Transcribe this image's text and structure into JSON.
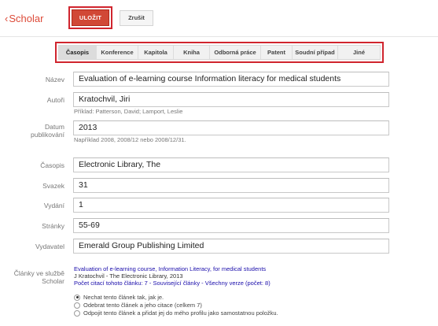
{
  "header": {
    "back_label": "Scholar",
    "save_label": "ULOŽIT",
    "cancel_label": "Zrušit"
  },
  "tabs": [
    {
      "label": "Časopis",
      "active": true
    },
    {
      "label": "Konference",
      "active": false
    },
    {
      "label": "Kapitola",
      "active": false
    },
    {
      "label": "Kniha",
      "active": false
    },
    {
      "label": "Odborná práce",
      "active": false
    },
    {
      "label": "Patent",
      "active": false
    },
    {
      "label": "Soudní případ",
      "active": false
    },
    {
      "label": "Jiné",
      "active": false
    }
  ],
  "form": {
    "title": {
      "label": "Název",
      "value": "Evaluation of e-learning course Information literacy for medical students"
    },
    "authors": {
      "label": "Autoři",
      "value": "Kratochvil, Jiri",
      "hint": "Příklad: Patterson, David; Lamport, Leslie"
    },
    "date": {
      "label_line1": "Datum",
      "label_line2": "publikování",
      "value": "2013",
      "hint": "Například 2008, 2008/12 nebo 2008/12/31."
    },
    "journal": {
      "label": "Časopis",
      "value": "Electronic Library, The"
    },
    "volume": {
      "label": "Svazek",
      "value": "31"
    },
    "issue": {
      "label": "Vydání",
      "value": "1"
    },
    "pages": {
      "label": "Stránky",
      "value": "55-69"
    },
    "publisher": {
      "label": "Vydavatel",
      "value": "Emerald Group Publishing Limited"
    }
  },
  "scholar_articles": {
    "label_line1": "Články ve službě",
    "label_line2": "Scholar",
    "title": "Evaluation of e-learning course, Information Literacy, for medical students",
    "author_line": "J Kratochvil - The Electronic Library, 2013",
    "links_line": "Počet citací tohoto článku: 7 - Související články - Všechny verze (počet: 8)",
    "options": [
      {
        "label": "Nechat tento článek tak, jak je.",
        "checked": true
      },
      {
        "label": "Odebrat tento článek a jeho citace (celkem 7)",
        "checked": false
      },
      {
        "label": "Odpojit tento článek a přidat jej do mého profilu jako samostatnou položku.",
        "checked": false
      }
    ]
  },
  "colors": {
    "accent": "#d14836",
    "highlight_outline": "#d0252e",
    "link": "#1a0dab"
  }
}
